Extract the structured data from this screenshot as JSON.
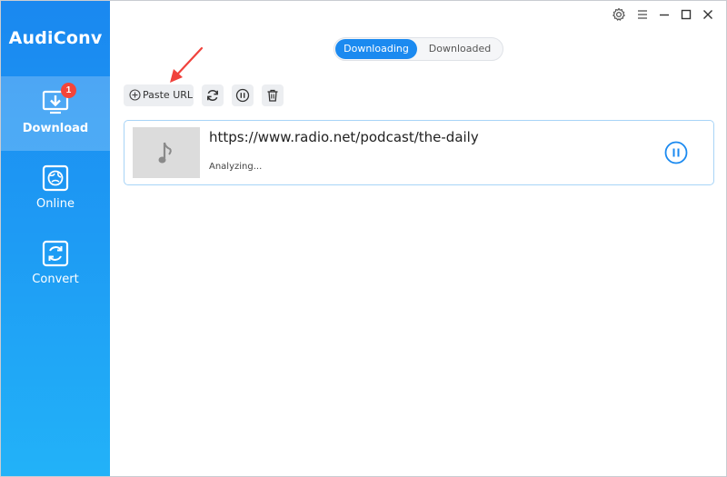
{
  "app": {
    "name": "AudiConv"
  },
  "sidebar": {
    "items": [
      {
        "label": "Download",
        "icon": "download-icon",
        "badge": "1",
        "active": true
      },
      {
        "label": "Online",
        "icon": "globe-icon"
      },
      {
        "label": "Convert",
        "icon": "convert-icon"
      }
    ]
  },
  "titlebar": {
    "icons": [
      "settings-icon",
      "menu-icon",
      "minimize-icon",
      "maximize-icon",
      "close-icon"
    ]
  },
  "tabs": {
    "downloading": "Downloading",
    "downloaded": "Downloaded",
    "active": "downloading"
  },
  "toolbar": {
    "paste_url_label": "Paste URL",
    "icons": [
      "refresh-icon",
      "pause-all-icon",
      "trash-icon"
    ]
  },
  "tasks": [
    {
      "url": "https://www.radio.net/podcast/the-daily",
      "status": "Analyzing...",
      "thumbnail_icon": "music-note-icon",
      "action_icon": "pause-icon"
    }
  ],
  "colors": {
    "accent": "#1b8af0",
    "badge": "#f4453a",
    "arrow": "#f0423c"
  }
}
